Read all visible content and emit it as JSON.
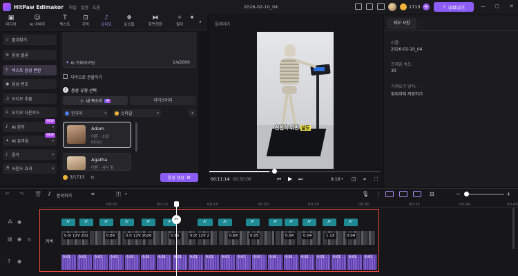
{
  "app": {
    "title": "HitPaw Edimakor",
    "menus": [
      "파일",
      "설정",
      "도움"
    ],
    "document": "2026-02-10_04",
    "credits": "1713",
    "export_label": "내보내기"
  },
  "tools": [
    "미디어",
    "AI 아바타",
    "텍스트",
    "자막",
    "오디오",
    "요소들",
    "화면전환",
    "필터"
  ],
  "left_nav": [
    {
      "label": "즐겨찾기",
      "icon": "☆"
    },
    {
      "label": "음성 클론",
      "icon": "≋"
    },
    {
      "label": "텍스트 음성 변환",
      "icon": "T"
    },
    {
      "label": "음성 변조",
      "icon": "◉"
    },
    {
      "label": "오디오 추출",
      "icon": "♫"
    },
    {
      "label": "오디오 다운로드",
      "icon": "⇩"
    },
    {
      "label": "AI 음악",
      "icon": "♪",
      "badge": "NEW"
    },
    {
      "label": "AI 효과음",
      "icon": "✦",
      "badge": "NEW"
    },
    {
      "label": "음악",
      "icon": "♪"
    },
    {
      "label": "사운드 효과",
      "icon": "♬"
    }
  ],
  "tts": {
    "ai_copywriting": "AI 카피라이팅",
    "char_count": "14/2000",
    "split_checkbox": "자막으로 분할하기",
    "step2": "음성 유형 선택",
    "my_voice_tab": "내 목소리",
    "ai_badge": "AI",
    "library_tab": "라이브러리",
    "lang_filter": "한국어",
    "style_filter": "스타일",
    "voices": [
      {
        "name": "Adam",
        "desc1": "어른 · 소셜",
        "desc2": "미디어"
      },
      {
        "name": "Agatha",
        "desc1": "어른 · 서사 및",
        "desc2": ""
      }
    ],
    "usage": "3/1713",
    "generate_label": "음성 생성"
  },
  "preview": {
    "label": "플레이어",
    "caption_plain": "천천히 뛰면 ",
    "caption_highlight": "살도",
    "time_current": "00:11:14",
    "time_total": "00:30:06",
    "ratio": "9:16",
    "progress": 0.35
  },
  "properties": {
    "tab": "세부 사항",
    "name_label": "이름:",
    "name_value": "2026-02-10_04",
    "fps_label": "프레임 속도:",
    "fps_value": "30",
    "save_label": "가져오기 방식:",
    "save_value": "원위치에 저장하기"
  },
  "timeline": {
    "split_label": "분리하기",
    "cover_label": "커버",
    "ticks": [
      "00:05",
      "00:10",
      "00:15",
      "00:20",
      "00:25",
      "00:30",
      "00:35",
      "00:40",
      "00:45"
    ],
    "text_chip": "Aᵀ",
    "speeds": [
      "0.04",
      "12V 202",
      "0.8X",
      "0.06",
      "12V 2026",
      "0.9X",
      "0.05",
      "12V 2",
      "0.8X",
      "0.05",
      "0.9X",
      "0.04",
      "1.1X",
      "0.04"
    ],
    "audio_label": "0:01"
  },
  "colors": {
    "accent": "#8b5cf6",
    "highlight_red": "#e84a3c",
    "teal": "#1f8a94",
    "audio": "#6a48b8"
  }
}
